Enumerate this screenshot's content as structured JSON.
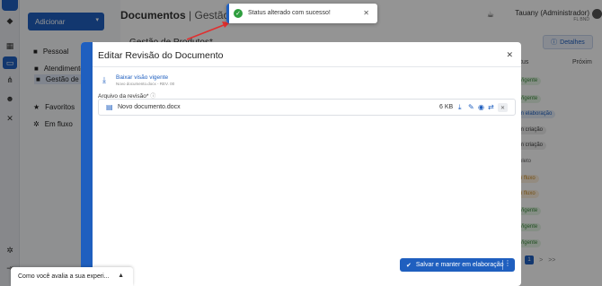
{
  "sidebar": {
    "add_button": "Adicionar",
    "items": [
      {
        "label": "Pessoal"
      },
      {
        "label": "Atendimento"
      },
      {
        "label": "Gestão de Prod"
      },
      {
        "label": "Favoritos"
      },
      {
        "label": "Em fluxo"
      }
    ]
  },
  "header": {
    "title": "Documentos",
    "separator": "|",
    "subtitle": "Gestão de P",
    "user_name": "Tauany (Administrador)",
    "user_role": "FL BND"
  },
  "content": {
    "title": "Gestão de Produtos*",
    "details_button": "Detalhes",
    "columns": [
      "tus",
      "Próxim"
    ],
    "statuses": [
      {
        "text": "Vigente",
        "tone": "green"
      },
      {
        "text": "Vigente",
        "tone": "green"
      },
      {
        "text": "m elaboração",
        "tone": "blue"
      },
      {
        "text": "m criação",
        "tone": "gray"
      },
      {
        "text": "m criação",
        "tone": "gray"
      },
      {
        "text": "oleto",
        "tone": "plain"
      },
      {
        "text": "n fluxo",
        "tone": "orange"
      },
      {
        "text": "n fluxo",
        "tone": "orange"
      },
      {
        "text": "Vigente",
        "tone": "green"
      },
      {
        "text": "Vigente",
        "tone": "green"
      },
      {
        "text": "Vigente",
        "tone": "green"
      }
    ],
    "pagination": {
      "prev": "<",
      "page": "1",
      "next": ">",
      "last": ">>"
    }
  },
  "modal": {
    "title": "Editar Revisão do Documento",
    "download_link": "Baixar visão vigente",
    "download_sub": "Novo documento.docx - REV. 00",
    "revision_label": "Arquivo da revisão*",
    "file": {
      "name": "Novo documento.docx",
      "size": "6 KB"
    },
    "save_button": "Salvar e manter em elaboração"
  },
  "toast": {
    "message": "Status alterado com sucesso!"
  },
  "feedback": {
    "text": "Como você avalia a sua experi..."
  },
  "colors": {
    "primary": "#1f5fbf",
    "success": "#2e9e3e",
    "arrow": "#e03030"
  }
}
